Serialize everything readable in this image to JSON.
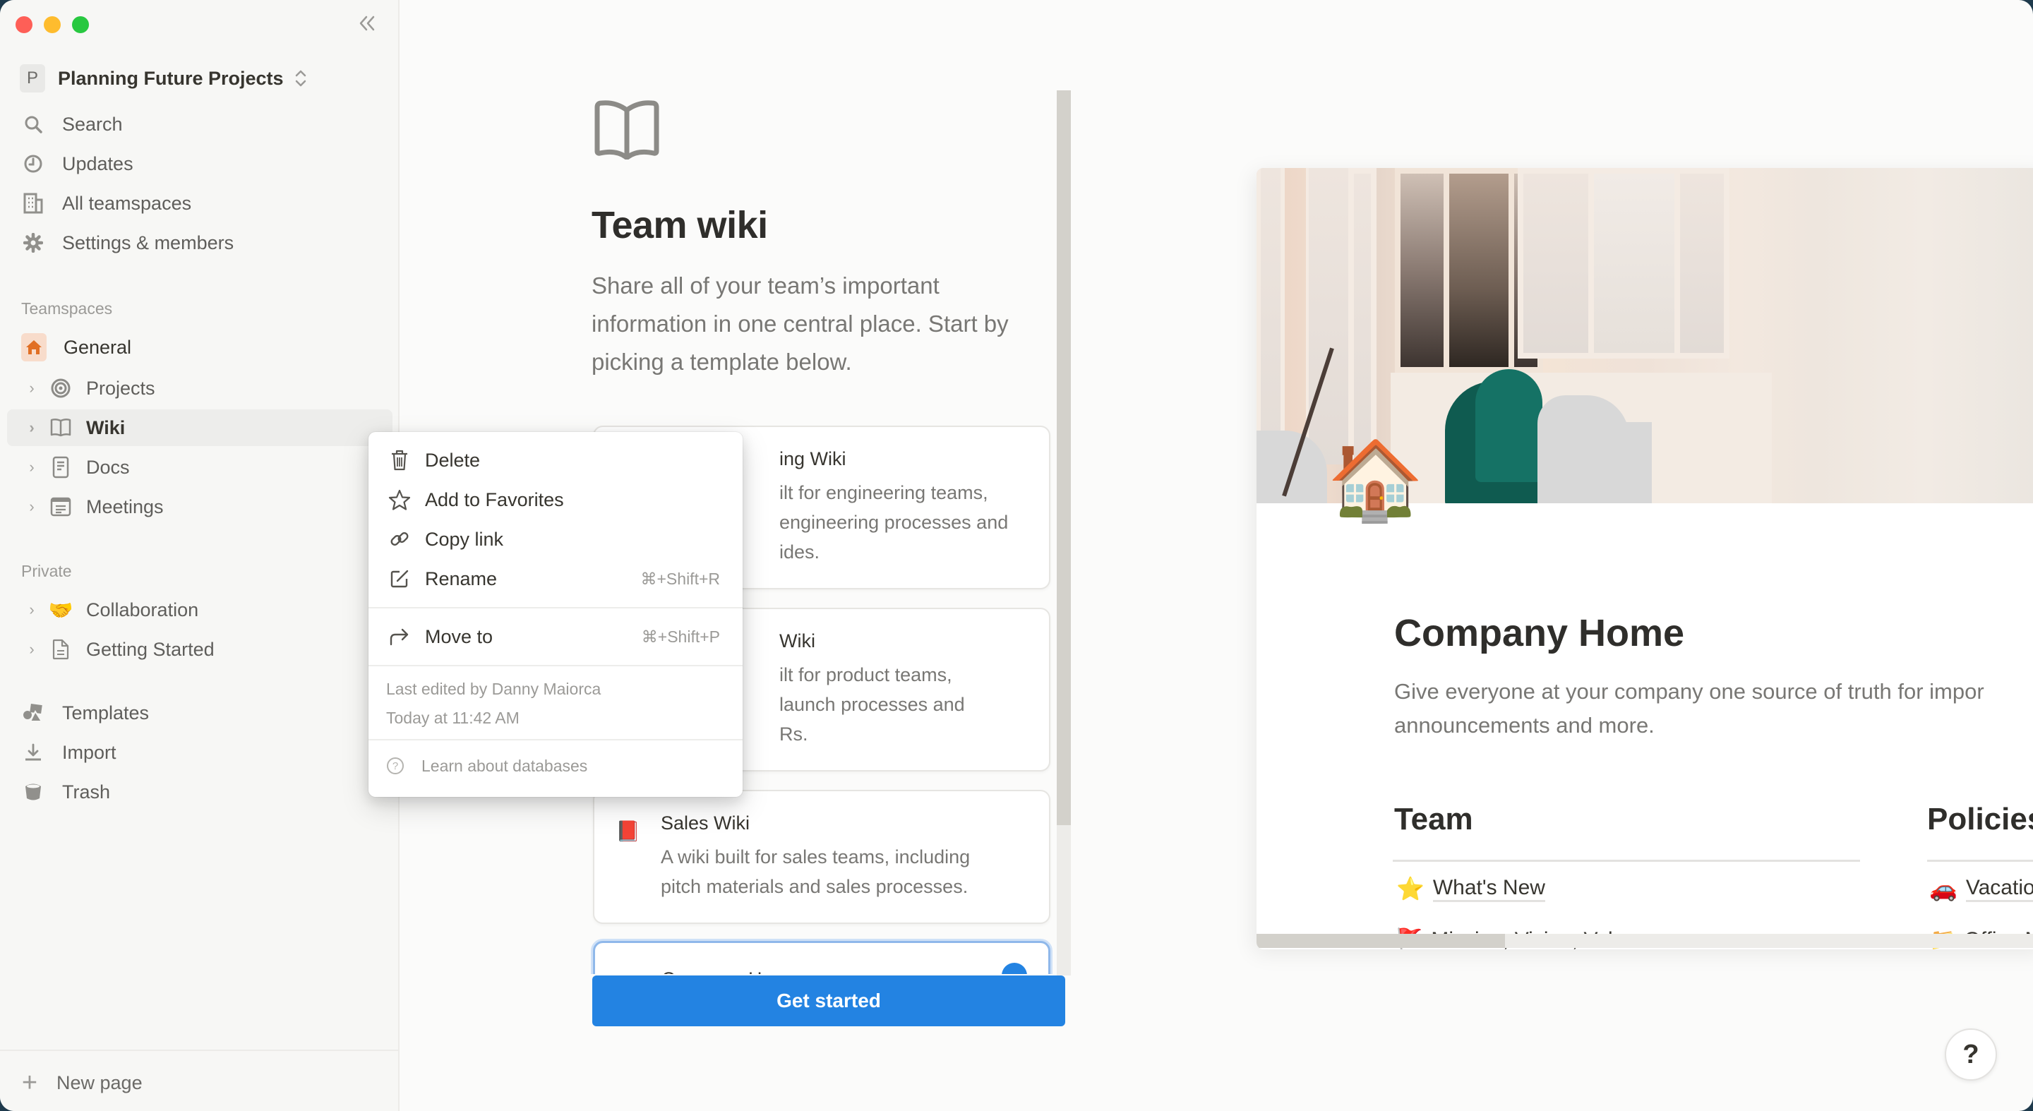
{
  "window": {
    "controls": [
      "close",
      "minimize",
      "zoom"
    ],
    "collapse_icon": "double-chevron-left-icon"
  },
  "sidebar": {
    "workspace": {
      "initial": "P",
      "name": "Planning Future Projects"
    },
    "nav": [
      {
        "label": "Search",
        "icon": "search-icon"
      },
      {
        "label": "Updates",
        "icon": "clock-icon"
      },
      {
        "label": "All teamspaces",
        "icon": "building-icon"
      },
      {
        "label": "Settings & members",
        "icon": "gear-icon"
      }
    ],
    "teamspaces_label": "Teamspaces",
    "teamspaces": [
      {
        "label": "General",
        "icon": "house-icon"
      },
      {
        "label": "Projects",
        "icon": "target-icon"
      },
      {
        "label": "Wiki",
        "icon": "book-icon",
        "active": true
      },
      {
        "label": "Docs",
        "icon": "document-icon"
      },
      {
        "label": "Meetings",
        "icon": "calendar-note-icon"
      }
    ],
    "private_label": "Private",
    "private": [
      {
        "label": "Collaboration",
        "icon": "handshake-emoji",
        "emoji": "🤝"
      },
      {
        "label": "Getting Started",
        "icon": "page-icon"
      }
    ],
    "utilities": [
      {
        "label": "Templates",
        "icon": "shapes-icon"
      },
      {
        "label": "Import",
        "icon": "download-icon"
      },
      {
        "label": "Trash",
        "icon": "trash-bin-icon"
      }
    ],
    "new_page": "New page"
  },
  "context_menu": {
    "items": [
      {
        "label": "Delete",
        "icon": "trash-icon",
        "shortcut": ""
      },
      {
        "label": "Add to Favorites",
        "icon": "star-icon",
        "shortcut": ""
      },
      {
        "label": "Copy link",
        "icon": "link-icon",
        "shortcut": ""
      },
      {
        "label": "Rename",
        "icon": "edit-icon",
        "shortcut": "⌘+Shift+R"
      },
      {
        "label": "Move to",
        "icon": "move-arrow-icon",
        "shortcut": "⌘+Shift+P"
      }
    ],
    "last_edited_by": "Last edited by Danny Maiorca",
    "last_edited_time": "Today at 11:42 AM",
    "learn": "Learn about databases"
  },
  "template_picker": {
    "title": "Team wiki",
    "description": "Share all of your team’s important information in one central place. Start by picking a template below.",
    "templates": [
      {
        "name": "Engineering Wiki",
        "visible_name": "ing Wiki",
        "description_lines": [
          "ilt for engineering teams,",
          " engineering processes and",
          "ides."
        ]
      },
      {
        "name": "Product Wiki",
        "visible_name": "Wiki",
        "description_lines": [
          "ilt for product teams,",
          " launch processes and",
          "Rs."
        ]
      },
      {
        "name": "Sales Wiki",
        "emoji": "📕",
        "description_lines": [
          "A wiki built for sales teams, including",
          "pitch materials and sales processes."
        ]
      },
      {
        "name": "Company Home",
        "selected": true
      }
    ],
    "scroll_position": 0.83,
    "get_started": "Get started"
  },
  "preview": {
    "icon_emoji": "🏠",
    "title": "Company Home",
    "description": "Give everyone at your company one source of truth for important announcements and more.",
    "description_lines": [
      "Give everyone at your company one source of truth for impor",
      "announcements and more."
    ],
    "columns": [
      {
        "heading": "Team",
        "links": [
          {
            "emoji": "⭐",
            "label": "What's New"
          },
          {
            "emoji": "🚩",
            "label": "Mission, Vision, Values"
          }
        ]
      },
      {
        "heading": "Policies",
        "links": [
          {
            "emoji": "🚗",
            "label": "Vacation Policy"
          },
          {
            "emoji": "📁",
            "label": "Office Manual"
          }
        ]
      }
    ],
    "h_scroll_fraction": 0.32
  },
  "help_button": "?",
  "colors": {
    "accent": "#2383e2",
    "sidebar_bg": "#f7f7f5",
    "general_icon_bg": "#f8dccb",
    "general_icon": "#e16f24"
  }
}
